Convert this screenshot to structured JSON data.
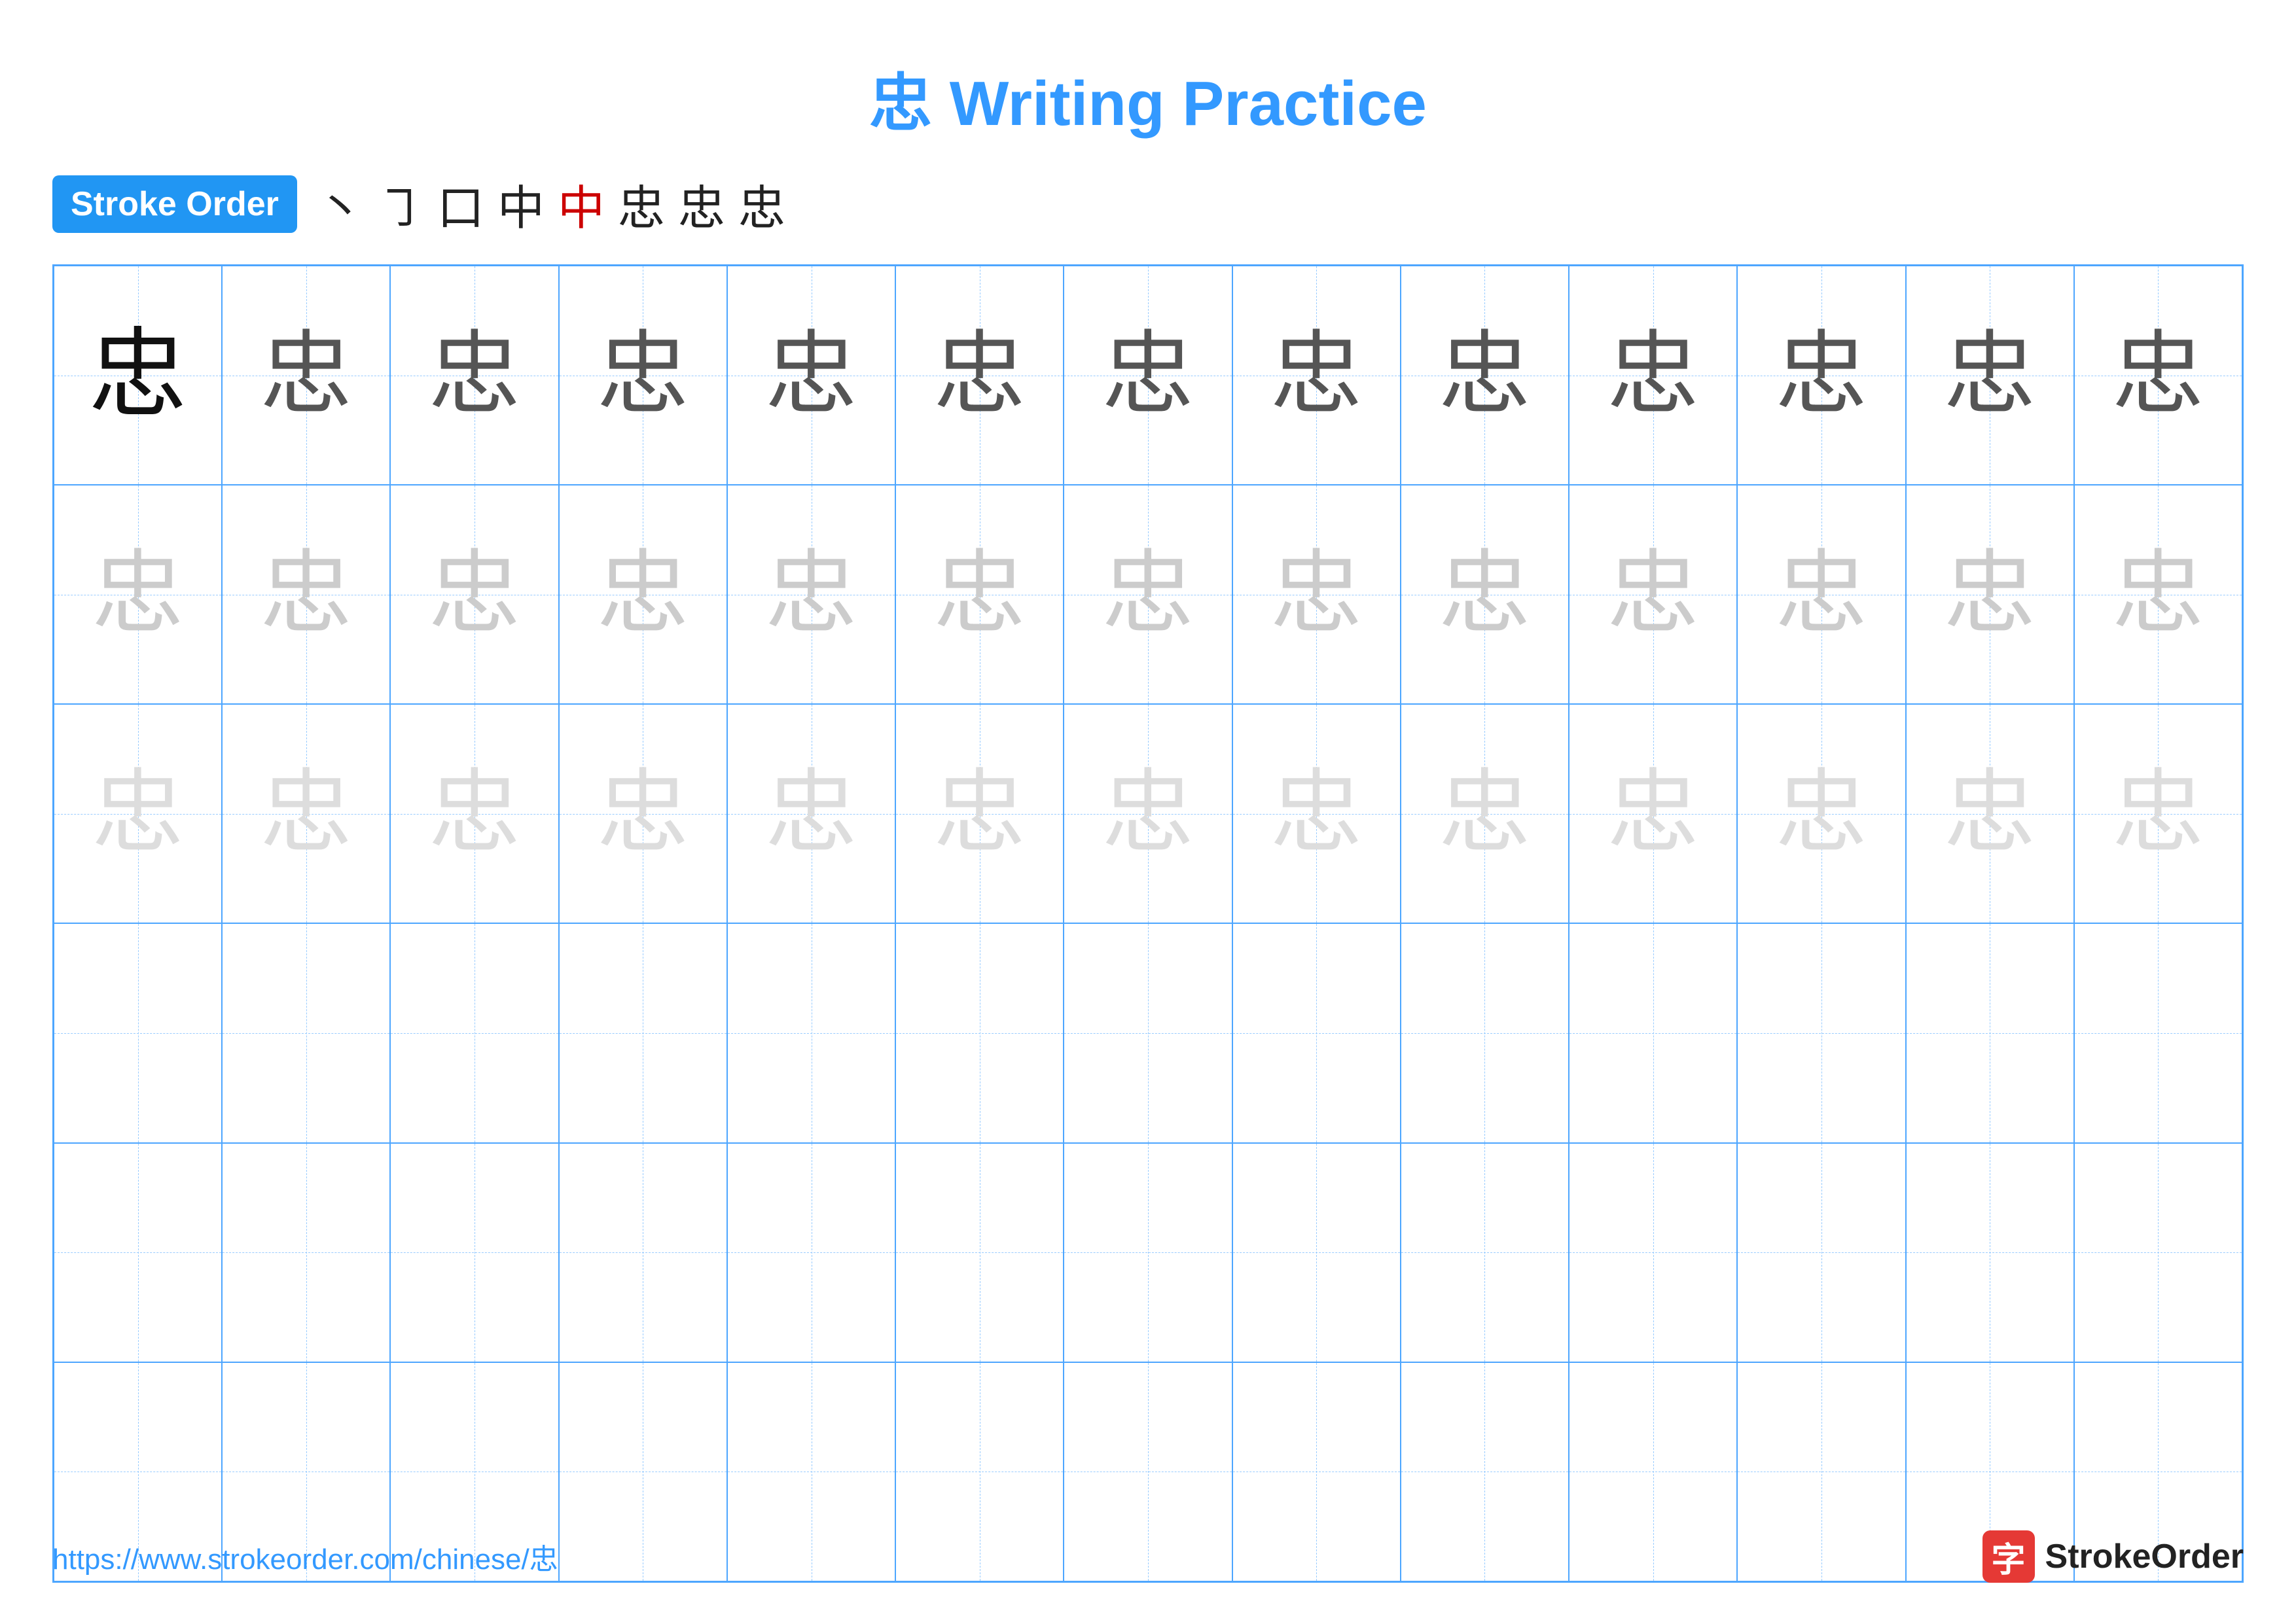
{
  "title": "忠 Writing Practice",
  "stroke_order": {
    "badge_label": "Stroke Order",
    "sequence": [
      "丶",
      "㇆",
      "口",
      "中",
      "中",
      "忠",
      "忠",
      "忠"
    ]
  },
  "grid": {
    "rows": 6,
    "cols": 13,
    "char": "忠",
    "row_styles": [
      "row1",
      "row2",
      "row3",
      "empty",
      "empty",
      "empty"
    ]
  },
  "footer": {
    "url": "https://www.strokeorder.com/chinese/忠",
    "logo_char": "字",
    "logo_name": "StrokeOrder"
  }
}
